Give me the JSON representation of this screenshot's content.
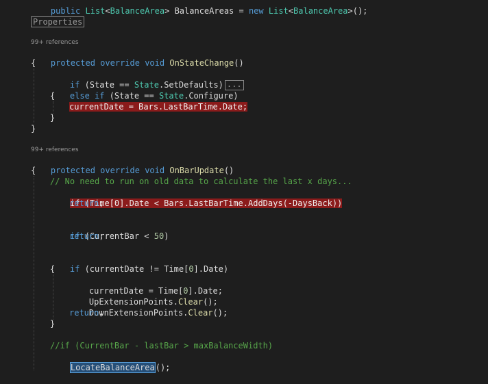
{
  "editor": {
    "top_line": {
      "kw1": "public",
      "type1": "List",
      "t1": "<",
      "type2": "BalanceArea",
      "t2": "> BalanceAreas = ",
      "kw2": "new",
      "type3": "List",
      "t3": "<",
      "type4": "BalanceArea",
      "t4": ">();"
    },
    "region_label": "Properties",
    "refs1": "99+ references",
    "sig1": {
      "kw1": "protected",
      "kw2": "override",
      "kw3": "void",
      "name": "OnStateChange",
      "rest": "()"
    },
    "brace_open": "{",
    "brace_close": "}",
    "l_if_state": {
      "kw": "if",
      "p1": " (State == ",
      "type": "State",
      "p2": ".SetDefaults)",
      "ellipsis": "..."
    },
    "l_elseif": {
      "kw": "else if",
      "p1": " (State == ",
      "type": "State",
      "p2": ".Configure)"
    },
    "l_curdate": "currentDate = Bars.LastBarTime.Date;",
    "refs2": "99+ references",
    "sig2": {
      "kw1": "protected",
      "kw2": "override",
      "kw3": "void",
      "name": "OnBarUpdate",
      "rest": "()"
    },
    "comment1": "// No need to run on old data to calculate the last x days...",
    "l_if_time": {
      "kw": "if",
      "p1": " (Time[0].Date < Bars.LastBarTime.",
      "method": "AddDays",
      "p2": "(-DaysBack))"
    },
    "return_kw": "return",
    "semi": ";",
    "l_if_cb": {
      "kw": "if",
      "p1": " (CurrentBar < ",
      "num": "50",
      "p2": ")"
    },
    "l_if_cd": {
      "kw": "if",
      "p1": " (currentDate != Time[",
      "num": "0",
      "p2": "].Date)"
    },
    "l_cd2": {
      "p1": "currentDate = Time[",
      "num": "0",
      "p2": "].Date;"
    },
    "l_up": {
      "p1": "UpExtensionPoints.",
      "method": "Clear",
      "p2": "();"
    },
    "l_down": {
      "p1": "DownExtensionPoints.",
      "method": "Clear",
      "p2": "();"
    },
    "comment2": "//if (CurrentBar - lastBar > maxBalanceWidth)",
    "l_locate": {
      "name": "LocateBalanceArea",
      "p2": "();"
    }
  },
  "colors": {
    "background": "#1e1e1e",
    "keyword": "#569cd6",
    "method": "#dcdcaa",
    "type": "#4ec9b0",
    "comment": "#57a64a",
    "breakpoint_highlight": "#8b1b1b"
  }
}
